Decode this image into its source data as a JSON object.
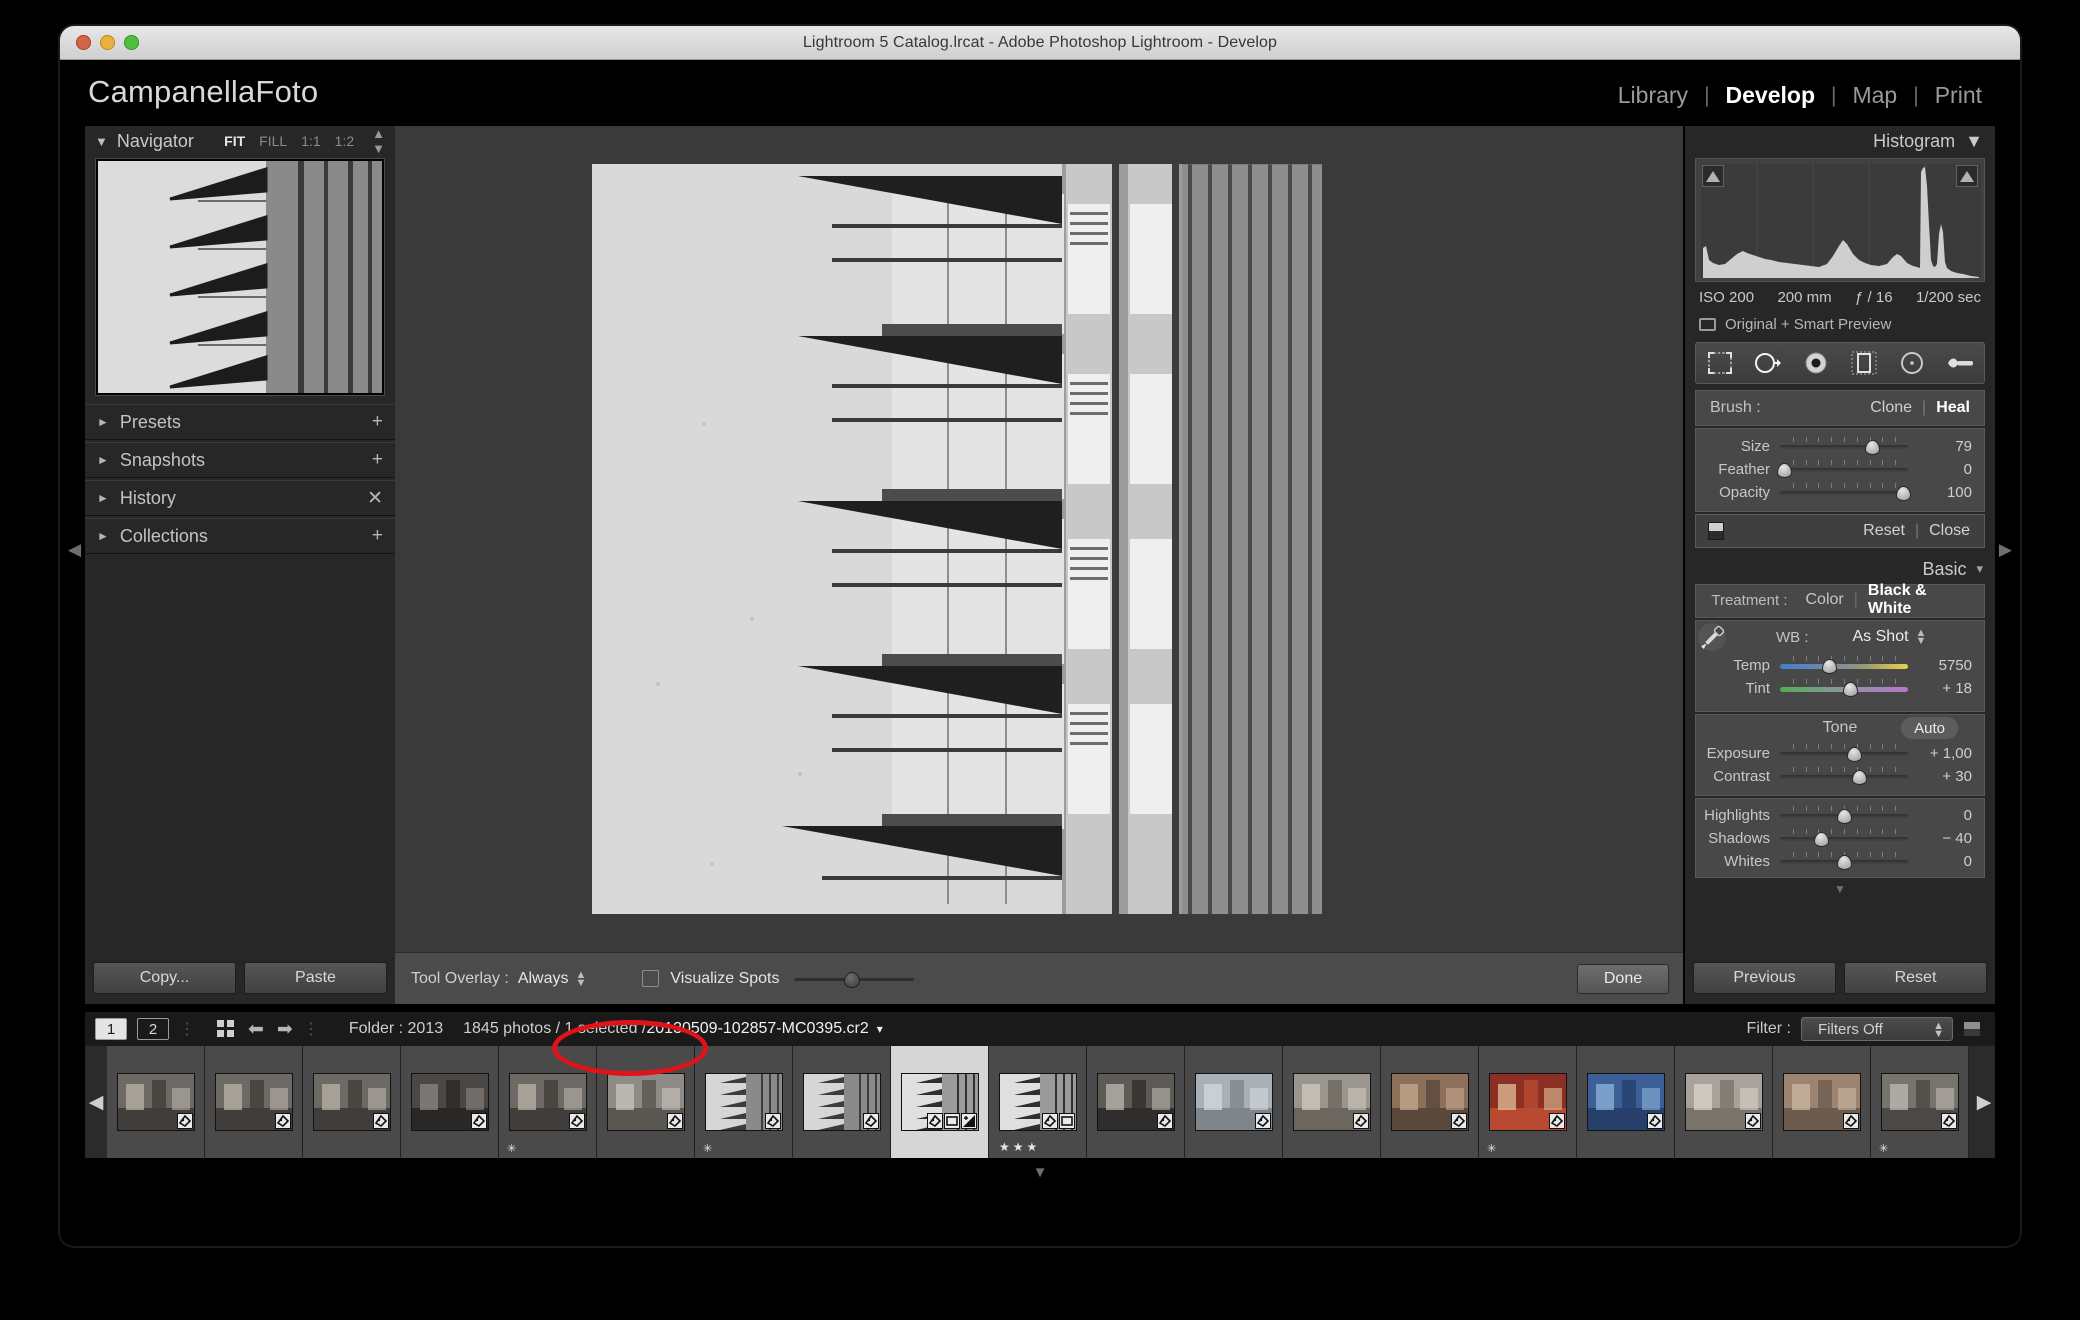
{
  "window": {
    "title": "Lightroom 5 Catalog.lrcat - Adobe Photoshop Lightroom - Develop",
    "traffic_lights": [
      "close-button",
      "minimize-button",
      "zoom-button"
    ]
  },
  "identity": {
    "name": "CampanellaFoto"
  },
  "modules": [
    {
      "label": "Library",
      "active": false
    },
    {
      "label": "Develop",
      "active": true
    },
    {
      "label": "Map",
      "active": false
    },
    {
      "label": "Print",
      "active": false
    }
  ],
  "module_separator": "|",
  "left_panel": {
    "navigator": {
      "title": "Navigator",
      "triangle": "▼",
      "zoom_levels": [
        {
          "label": "FIT",
          "active": true
        },
        {
          "label": "FILL",
          "active": false
        },
        {
          "label": "1:1",
          "active": false
        },
        {
          "label": "1:2",
          "active": false
        }
      ]
    },
    "groups": [
      {
        "label": "Presets",
        "triangle": "►",
        "action": "+"
      },
      {
        "label": "Snapshots",
        "triangle": "►",
        "action": "+"
      },
      {
        "label": "History",
        "triangle": "►",
        "action": "✕"
      },
      {
        "label": "Collections",
        "triangle": "►",
        "action": "+"
      }
    ],
    "copy_label": "Copy...",
    "paste_label": "Paste"
  },
  "histogram_panel": {
    "title": "Histogram",
    "triangle": "▼",
    "exif": {
      "iso": "ISO 200",
      "focal": "200 mm",
      "aperture": "ƒ / 16",
      "shutter": "1/200 sec"
    },
    "preview_status": "Original + Smart Preview"
  },
  "tool_strip": {
    "tools": [
      {
        "name": "crop-overlay-tool",
        "active": false
      },
      {
        "name": "spot-removal-tool",
        "active": true
      },
      {
        "name": "red-eye-correction-tool",
        "active": false
      },
      {
        "name": "graduated-filter-tool",
        "active": false
      },
      {
        "name": "radial-filter-tool",
        "active": false
      },
      {
        "name": "adjustment-brush-tool",
        "active": false
      }
    ]
  },
  "brush_panel": {
    "label": "Brush :",
    "modes": [
      {
        "label": "Clone",
        "active": false
      },
      {
        "label": "Heal",
        "active": true
      }
    ],
    "sliders": [
      {
        "name": "Size",
        "value": "79",
        "pct": 72
      },
      {
        "name": "Feather",
        "value": "0",
        "pct": 3
      },
      {
        "name": "Opacity",
        "value": "100",
        "pct": 96
      }
    ],
    "reset_label": "Reset",
    "close_label": "Close"
  },
  "basic_panel": {
    "title": "Basic",
    "treatment_label": "Treatment :",
    "treatments": [
      {
        "label": "Color",
        "active": false
      },
      {
        "label": "Black & White",
        "active": true
      }
    ],
    "wb_label": "WB :",
    "wb_value": "As Shot",
    "wb_sliders": [
      {
        "name": "Temp",
        "value": "5750",
        "pct": 38,
        "track": "temp"
      },
      {
        "name": "Tint",
        "value": "+ 18",
        "pct": 55,
        "track": "tint"
      }
    ],
    "tone_label": "Tone",
    "auto_label": "Auto",
    "tone_sliders": [
      {
        "name": "Exposure",
        "value": "+ 1,00",
        "pct": 58
      },
      {
        "name": "Contrast",
        "value": "+ 30",
        "pct": 62
      }
    ],
    "detail_sliders": [
      {
        "name": "Highlights",
        "value": "0",
        "pct": 50
      },
      {
        "name": "Shadows",
        "value": "− 40",
        "pct": 32
      },
      {
        "name": "Whites",
        "value": "0",
        "pct": 50
      }
    ],
    "previous_label": "Previous",
    "reset_label": "Reset"
  },
  "toolbar": {
    "tool_overlay_label": "Tool Overlay :",
    "tool_overlay_value": "Always",
    "visualize_spots_label": "Visualize Spots",
    "visualize_spots_checked": false,
    "visualize_slider_pct": 48,
    "done_label": "Done"
  },
  "filmstrip_bar": {
    "screen_buttons": [
      {
        "label": "1",
        "active": true
      },
      {
        "label": "2",
        "active": false
      }
    ],
    "folder_label": "Folder : 2013",
    "counts": "1845 photos / 1 selected /",
    "filename": "20130509-102857-MC0395.cr2",
    "filter_label": "Filter :",
    "filter_value": "Filters Off"
  },
  "filmstrip": {
    "thumbs": [
      {
        "kind": "interior-people",
        "selected": false,
        "badges": 1,
        "stars": 0,
        "flag": false
      },
      {
        "kind": "interior-people",
        "selected": false,
        "badges": 1,
        "stars": 0,
        "flag": false
      },
      {
        "kind": "interior-people",
        "selected": false,
        "badges": 1,
        "stars": 0,
        "flag": false
      },
      {
        "kind": "interior-dark",
        "selected": false,
        "badges": 1,
        "stars": 0,
        "flag": false
      },
      {
        "kind": "interior-people",
        "selected": false,
        "badges": 1,
        "stars": 0,
        "flag": true
      },
      {
        "kind": "escalator",
        "selected": false,
        "badges": 1,
        "stars": 0,
        "flag": false
      },
      {
        "kind": "building-bw",
        "selected": false,
        "badges": 1,
        "stars": 0,
        "flag": true
      },
      {
        "kind": "building-bw",
        "selected": false,
        "badges": 1,
        "stars": 0,
        "flag": false
      },
      {
        "kind": "building-facade",
        "selected": true,
        "badges": 3,
        "stars": 0,
        "flag": false
      },
      {
        "kind": "building-facade",
        "selected": false,
        "badges": 2,
        "stars": 3,
        "flag": false
      },
      {
        "kind": "underpass",
        "selected": false,
        "badges": 1,
        "stars": 0,
        "flag": false
      },
      {
        "kind": "bridge-water",
        "selected": false,
        "badges": 1,
        "stars": 0,
        "flag": false
      },
      {
        "kind": "street-crowd",
        "selected": false,
        "badges": 1,
        "stars": 0,
        "flag": false
      },
      {
        "kind": "street-shops",
        "selected": false,
        "badges": 1,
        "stars": 0,
        "flag": false
      },
      {
        "kind": "red-lanterns",
        "selected": false,
        "badges": 1,
        "stars": 0,
        "flag": true
      },
      {
        "kind": "blue-mural",
        "selected": false,
        "badges": 1,
        "stars": 0,
        "flag": false
      },
      {
        "kind": "group-portrait",
        "selected": false,
        "badges": 1,
        "stars": 0,
        "flag": false
      },
      {
        "kind": "street-market",
        "selected": false,
        "badges": 1,
        "stars": 0,
        "flag": false
      },
      {
        "kind": "person-walking",
        "selected": false,
        "badges": 1,
        "stars": 0,
        "flag": true
      }
    ],
    "prev_arrow": "◀",
    "next_arrow": "▶"
  },
  "annotation": {
    "highlight": "red-ellipse-around-visualize-spots",
    "color": "#e2121a"
  },
  "panel_arrows": {
    "top": "▲",
    "bottom": "▼",
    "left": "◀",
    "right": "▶"
  }
}
